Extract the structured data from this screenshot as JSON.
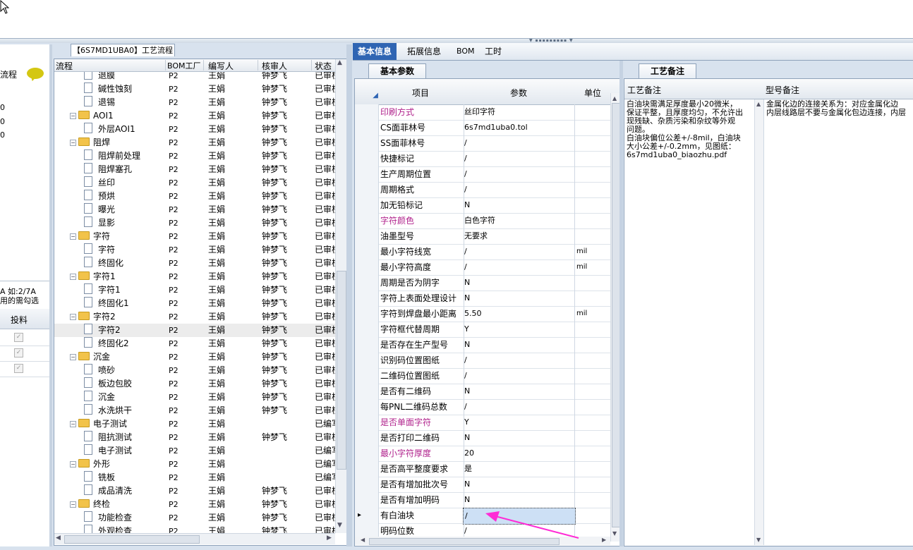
{
  "left_panel": {
    "tab_label": "流程",
    "numbers": [
      "0",
      "0",
      "0"
    ],
    "note_lines": [
      "A 如:2/7A",
      "用的需勾选"
    ],
    "grid_header": "投料",
    "checks": [
      "✓",
      "✓",
      "✓"
    ]
  },
  "tree": {
    "caption": "【6S7MD1UBA0】工艺流程",
    "headers": [
      "流程",
      "BOM工厂",
      "编写人",
      "核审人",
      "状态"
    ],
    "rows": [
      {
        "name": "退膜",
        "level": 2,
        "bom": "P2",
        "writer": "王娟",
        "reviewer": "钟梦飞",
        "status": "已审核"
      },
      {
        "name": "碱性蚀刻",
        "level": 2,
        "bom": "P2",
        "writer": "王娟",
        "reviewer": "钟梦飞",
        "status": "已审核"
      },
      {
        "name": "退锡",
        "level": 2,
        "bom": "P2",
        "writer": "王娟",
        "reviewer": "钟梦飞",
        "status": "已审核"
      },
      {
        "name": "AOI1",
        "level": 1,
        "bom": "P2",
        "writer": "王娟",
        "reviewer": "钟梦飞",
        "status": "已审核"
      },
      {
        "name": "外层AOI1",
        "level": 2,
        "bom": "P2",
        "writer": "王娟",
        "reviewer": "钟梦飞",
        "status": "已审核"
      },
      {
        "name": "阻焊",
        "level": 1,
        "bom": "P2",
        "writer": "王娟",
        "reviewer": "钟梦飞",
        "status": "已审核"
      },
      {
        "name": "阻焊前处理",
        "level": 2,
        "bom": "P2",
        "writer": "王娟",
        "reviewer": "钟梦飞",
        "status": "已审核"
      },
      {
        "name": "阻焊塞孔",
        "level": 2,
        "bom": "P2",
        "writer": "王娟",
        "reviewer": "钟梦飞",
        "status": "已审核"
      },
      {
        "name": "丝印",
        "level": 2,
        "bom": "P2",
        "writer": "王娟",
        "reviewer": "钟梦飞",
        "status": "已审核"
      },
      {
        "name": "预烘",
        "level": 2,
        "bom": "P2",
        "writer": "王娟",
        "reviewer": "钟梦飞",
        "status": "已审核"
      },
      {
        "name": "曝光",
        "level": 2,
        "bom": "P2",
        "writer": "王娟",
        "reviewer": "钟梦飞",
        "status": "已审核"
      },
      {
        "name": "显影",
        "level": 2,
        "bom": "P2",
        "writer": "王娟",
        "reviewer": "钟梦飞",
        "status": "已审核"
      },
      {
        "name": "字符",
        "level": 1,
        "bom": "P2",
        "writer": "王娟",
        "reviewer": "钟梦飞",
        "status": "已审核"
      },
      {
        "name": "字符",
        "level": 2,
        "bom": "P2",
        "writer": "王娟",
        "reviewer": "钟梦飞",
        "status": "已审核"
      },
      {
        "name": "终固化",
        "level": 2,
        "bom": "P2",
        "writer": "王娟",
        "reviewer": "钟梦飞",
        "status": "已审核"
      },
      {
        "name": "字符1",
        "level": 1,
        "bom": "P2",
        "writer": "王娟",
        "reviewer": "钟梦飞",
        "status": "已审核"
      },
      {
        "name": "字符1",
        "level": 2,
        "bom": "P2",
        "writer": "王娟",
        "reviewer": "钟梦飞",
        "status": "已审核"
      },
      {
        "name": "终固化1",
        "level": 2,
        "bom": "P2",
        "writer": "王娟",
        "reviewer": "钟梦飞",
        "status": "已审核"
      },
      {
        "name": "字符2",
        "level": 1,
        "bom": "P2",
        "writer": "王娟",
        "reviewer": "钟梦飞",
        "status": "已审核"
      },
      {
        "name": "字符2",
        "level": 2,
        "bom": "P2",
        "writer": "王娟",
        "reviewer": "钟梦飞",
        "status": "已审核",
        "selected": true
      },
      {
        "name": "终固化2",
        "level": 2,
        "bom": "P2",
        "writer": "王娟",
        "reviewer": "钟梦飞",
        "status": "已审核"
      },
      {
        "name": "沉金",
        "level": 1,
        "bom": "P2",
        "writer": "王娟",
        "reviewer": "钟梦飞",
        "status": "已审核"
      },
      {
        "name": "喷砂",
        "level": 2,
        "bom": "P2",
        "writer": "王娟",
        "reviewer": "钟梦飞",
        "status": "已审核"
      },
      {
        "name": "板边包胶",
        "level": 2,
        "bom": "P2",
        "writer": "王娟",
        "reviewer": "钟梦飞",
        "status": "已审核"
      },
      {
        "name": "沉金",
        "level": 2,
        "bom": "P2",
        "writer": "王娟",
        "reviewer": "钟梦飞",
        "status": "已审核"
      },
      {
        "name": "水洗烘干",
        "level": 2,
        "bom": "P2",
        "writer": "王娟",
        "reviewer": "钟梦飞",
        "status": "已审核"
      },
      {
        "name": "电子测试",
        "level": 1,
        "bom": "P2",
        "writer": "王娟",
        "reviewer": "",
        "status": "已编写"
      },
      {
        "name": "阻抗测试",
        "level": 2,
        "bom": "P2",
        "writer": "王娟",
        "reviewer": "钟梦飞",
        "status": "已审核"
      },
      {
        "name": "电子测试",
        "level": 2,
        "bom": "P2",
        "writer": "王娟",
        "reviewer": "",
        "status": "已编写"
      },
      {
        "name": "外形",
        "level": 1,
        "bom": "P2",
        "writer": "王娟",
        "reviewer": "",
        "status": "已编写"
      },
      {
        "name": "铣板",
        "level": 2,
        "bom": "P2",
        "writer": "王娟",
        "reviewer": "",
        "status": "已编写"
      },
      {
        "name": "成品清洗",
        "level": 2,
        "bom": "P2",
        "writer": "王娟",
        "reviewer": "钟梦飞",
        "status": "已审核"
      },
      {
        "name": "终检",
        "level": 1,
        "bom": "P2",
        "writer": "王娟",
        "reviewer": "钟梦飞",
        "status": "已审核"
      },
      {
        "name": "功能检查",
        "level": 2,
        "bom": "P2",
        "writer": "王娟",
        "reviewer": "钟梦飞",
        "status": "已审核"
      },
      {
        "name": "外观检查",
        "level": 2,
        "bom": "P2",
        "writer": "王娟",
        "reviewer": "钟梦飞",
        "status": "已审核"
      }
    ]
  },
  "tabs": [
    "基本信息",
    "拓展信息",
    "BOM",
    "工时"
  ],
  "subtab_params": "基本参数",
  "subtab_notes": "工艺备注",
  "params": {
    "headers": [
      "项目",
      "参数",
      "单位"
    ],
    "rows": [
      {
        "k": "印刷方式",
        "v": "丝印字符",
        "u": "",
        "hl": true
      },
      {
        "k": "CS面菲林号",
        "v": "6s7md1uba0.tol",
        "u": ""
      },
      {
        "k": "SS面菲林号",
        "v": "/",
        "u": ""
      },
      {
        "k": "快捷标记",
        "v": "/",
        "u": ""
      },
      {
        "k": "生产周期位置",
        "v": "/",
        "u": ""
      },
      {
        "k": "周期格式",
        "v": "/",
        "u": ""
      },
      {
        "k": "加无铅标记",
        "v": "N",
        "u": ""
      },
      {
        "k": "字符颜色",
        "v": "白色字符",
        "u": "",
        "hl": true
      },
      {
        "k": "油墨型号",
        "v": "无要求",
        "u": ""
      },
      {
        "k": "最小字符线宽",
        "v": "/",
        "u": "mil"
      },
      {
        "k": "最小字符高度",
        "v": "/",
        "u": "mil"
      },
      {
        "k": "周期是否为阴字",
        "v": "N",
        "u": ""
      },
      {
        "k": "字符上表面处理设计",
        "v": "N",
        "u": ""
      },
      {
        "k": "字符到焊盘最小距离",
        "v": "5.50",
        "u": "mil"
      },
      {
        "k": "字符框代替周期",
        "v": "Y",
        "u": ""
      },
      {
        "k": "是否存在生产型号",
        "v": "N",
        "u": ""
      },
      {
        "k": "识别码位置图纸",
        "v": "/",
        "u": ""
      },
      {
        "k": "二维码位置图纸",
        "v": "/",
        "u": ""
      },
      {
        "k": "是否有二维码",
        "v": "N",
        "u": ""
      },
      {
        "k": "每PNL二维码总数",
        "v": "/",
        "u": ""
      },
      {
        "k": "是否单面字符",
        "v": "Y",
        "u": "",
        "hl": true
      },
      {
        "k": "是否打印二维码",
        "v": "N",
        "u": ""
      },
      {
        "k": "最小字符厚度",
        "v": "20",
        "u": "",
        "hl": true
      },
      {
        "k": "是否高平整度要求",
        "v": "是",
        "u": ""
      },
      {
        "k": "是否有增加批次号",
        "v": "N",
        "u": ""
      },
      {
        "k": "是否有增加明码",
        "v": "N",
        "u": ""
      },
      {
        "k": "有白油块",
        "v": "/",
        "u": "",
        "current": true
      },
      {
        "k": "明码位数",
        "v": "/",
        "u": ""
      }
    ]
  },
  "notes": {
    "process_header": "工艺备注",
    "model_header": "型号备注",
    "process_text": "白油块需满足厚度最小20微米，\n保证平整，且厚度均匀，不允许出\n现残缺、杂质污染和杂纹等外观\n问题。\n白油块偏位公差+/-8mil，白油块\n大小公差+/-0.2mm，见图纸：\n6s7md1uba0_biaozhu.pdf",
    "model_text": "金属化边的连接关系为：对应金属化边\n内层线路层不要与金属化包边连接，内层"
  },
  "colors": {
    "accent": "#2f65b3",
    "highlight_key": "#b0228c",
    "arrow": "#ff2bd6"
  }
}
